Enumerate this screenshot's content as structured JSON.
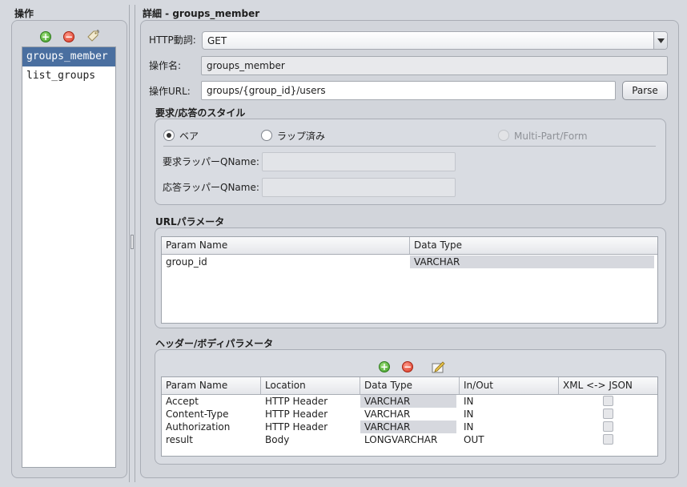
{
  "left_panel": {
    "title": "操作",
    "operations": [
      "groups_member",
      "list_groups"
    ],
    "selected_index": 0
  },
  "detail": {
    "title": "詳細 - groups_member",
    "http_method_label": "HTTP動詞:",
    "http_method_value": "GET",
    "op_name_label": "操作名:",
    "op_name_value": "groups_member",
    "op_url_label": "操作URL:",
    "op_url_value": "groups/{group_id}/users",
    "parse_button": "Parse"
  },
  "style_section": {
    "title": "要求/応答のスタイル",
    "options": [
      "ベア",
      "ラップ済み",
      "Multi-Part/Form"
    ],
    "selected": "ベア",
    "request_wrapper_label": "要求ラッパーQName:",
    "response_wrapper_label": "応答ラッパーQName:"
  },
  "url_params": {
    "title": "URLパラメータ",
    "columns": [
      "Param Name",
      "Data Type"
    ],
    "rows": [
      [
        "group_id",
        "VARCHAR"
      ]
    ]
  },
  "header_body_params": {
    "title": "ヘッダー/ボディパラメータ",
    "columns": [
      "Param Name",
      "Location",
      "Data Type",
      "In/Out",
      "XML <-> JSON"
    ],
    "rows": [
      [
        "Accept",
        "HTTP Header",
        "VARCHAR",
        "IN"
      ],
      [
        "Content-Type",
        "HTTP Header",
        "VARCHAR",
        "IN"
      ],
      [
        "Authorization",
        "HTTP Header",
        "VARCHAR",
        "IN"
      ],
      [
        "result",
        "Body",
        "LONGVARCHAR",
        "OUT"
      ]
    ]
  },
  "icons": {
    "add": "plus-icon",
    "remove": "minus-icon",
    "tag": "tag-icon",
    "edit": "edit-icon",
    "dropdown": "chevron-down-icon"
  }
}
